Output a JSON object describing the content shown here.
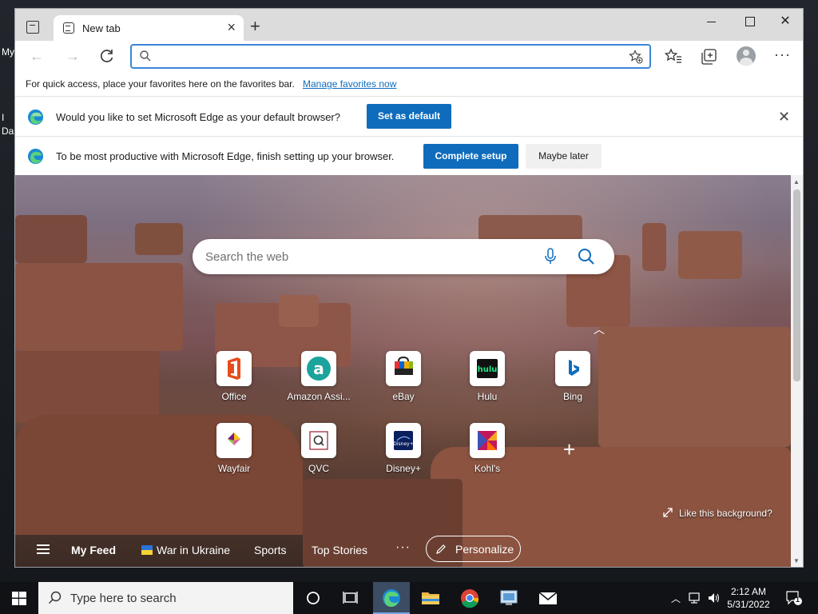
{
  "desktop": {
    "edge_texts": [
      "My",
      "I",
      "Da"
    ]
  },
  "browser": {
    "tab_title": "New tab",
    "address_value": "",
    "favorites_bar": {
      "text": "For quick access, place your favorites here on the favorites bar.",
      "link": "Manage favorites now"
    },
    "infobar_default": {
      "message": "Would you like to set Microsoft Edge as your default browser?",
      "button": "Set as default"
    },
    "infobar_setup": {
      "message": "To be most productive with Microsoft Edge, finish setting up your browser.",
      "primary_button": "Complete setup",
      "secondary_button": "Maybe later"
    },
    "more_label": "···"
  },
  "newtab": {
    "search_placeholder": "Search the web",
    "tiles": [
      {
        "label": "Office",
        "icon": "office-icon",
        "color": "#e74c1c"
      },
      {
        "label": "Amazon Assi...",
        "icon": "amazon-assistant-icon",
        "color": "#1ba39c"
      },
      {
        "label": "eBay",
        "icon": "ebay-icon",
        "color": "#e53238"
      },
      {
        "label": "Hulu",
        "icon": "hulu-icon",
        "color": "#1ce783"
      },
      {
        "label": "Bing",
        "icon": "bing-icon",
        "color": "#0f6cbd"
      },
      {
        "label": "Wayfair",
        "icon": "wayfair-icon",
        "color": "#7f187f"
      },
      {
        "label": "QVC",
        "icon": "qvc-icon",
        "color": "#9b1b30"
      },
      {
        "label": "Disney+",
        "icon": "disney-plus-icon",
        "color": "#113ccf"
      },
      {
        "label": "Kohl's",
        "icon": "kohls-icon",
        "color": "#8b2a5a"
      }
    ],
    "like_background": "Like this background?",
    "feed": {
      "my_feed": "My Feed",
      "war_in_ukraine": "War in Ukraine",
      "sports": "Sports",
      "top_stories": "Top Stories",
      "more": "···",
      "personalize": "Personalize"
    }
  },
  "taskbar": {
    "search_text": "Type here to search",
    "clock_time": "2:12 AM",
    "clock_date": "5/31/2022",
    "notification_count": "1"
  }
}
